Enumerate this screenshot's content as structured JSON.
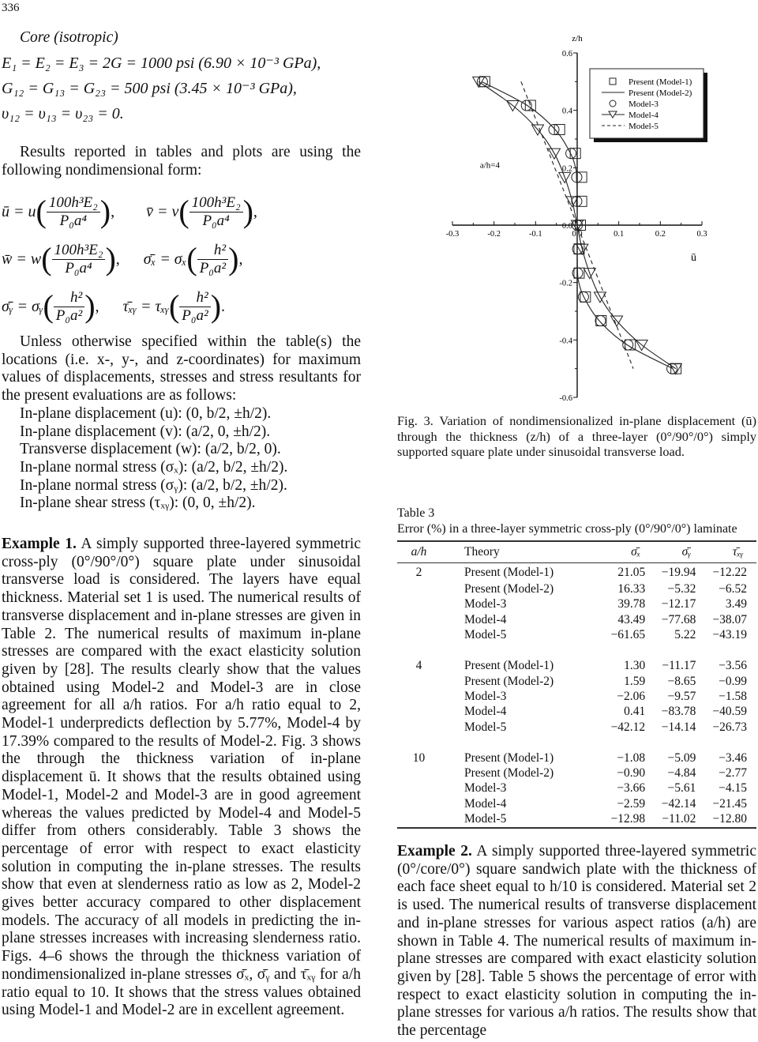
{
  "page": {
    "number": "336"
  },
  "left_column": {
    "core_heading": "Core (isotropic)",
    "material_lines": [
      "E₁ = E₂ = E₃ = 2G = 1000 psi  (6.90 × 10⁻³ GPa),",
      "G₁₂ = G₁₃ = G₂₃ = 500 psi  (3.45 × 10⁻³ GPa),",
      "υ₁₂ = υ₁₃ = υ₂₃ = 0."
    ],
    "intro_paragraph": "Results reported in tables and plots are using the following nondimensional form:",
    "equations": {
      "u_lhs": "ū = u",
      "v_lhs": "v̄ = v",
      "w_lhs": "w̄ = w",
      "sx_lhs": "σ̄ₓ = σₓ",
      "sy_lhs": "σ̄ᵧ = σᵧ",
      "txy_lhs": "τ̄ₓᵧ = τₓᵧ",
      "frac_disp_num": "100h³E₂",
      "frac_disp_den": "P₀a⁴",
      "frac_stress_num": "h²",
      "frac_stress_den": "P₀a²",
      "comma": ",",
      "period": "."
    },
    "locations_paragraph": "Unless otherwise specified within the table(s) the locations (i.e. x-, y-, and z-coordinates) for maximum values of displacements, stresses and stress resultants for the present evaluations are as follows:",
    "locations": [
      "In-plane displacement (u): (0, b/2, ±h/2).",
      "In-plane displacement (v): (a/2, 0, ±h/2).",
      "Transverse displacement (w): (a/2, b/2, 0).",
      "In-plane normal stress (σₓ): (a/2, b/2, ±h/2).",
      "In-plane normal stress (σᵧ): (a/2, b/2, ±h/2).",
      "In-plane shear stress (τₓᵧ): (0, 0, ±h/2)."
    ],
    "example1_label": "Example 1.",
    "example1_text": " A simply supported three-layered symmetric cross-ply (0°/90°/0°) square plate under sinusoidal transverse load is considered. The layers have equal thickness. Material set 1 is used. The numerical results of transverse displacement and in-plane stresses are given in Table 2. The numerical results of maximum in-plane stresses are compared with the exact elasticity solution given by [28]. The results clearly show that the values obtained using Model-2 and Model-3 are in close agreement for all a/h ratios. For a/h ratio equal to 2, Model-1 underpredicts deflection by 5.77%, Model-4 by 17.39% compared to the results of Model-2. Fig. 3 shows the through the thickness variation of in-plane displacement ū. It shows that the results obtained using Model-1, Model-2 and Model-3 are in good agreement whereas the values predicted by Model-4 and Model-5 differ from others considerably. Table 3 shows the percentage of error with respect to exact elasticity solution in computing the in-plane stresses. The results show that even at slenderness ratio as low as 2, Model-2 gives better accuracy compared to other displacement models. The accuracy of all models in predicting the in-plane stresses increases with increasing slenderness ratio. Figs. 4–6 shows the through the thickness variation of nondimensionalized in-plane stresses σ̄ₓ, σ̄ᵧ and τ̄ₓᵧ for a/h ratio equal to 10. It shows that the stress values obtained using Model-1 and Model-2 are in excellent agreement."
  },
  "chart_data": {
    "type": "scatter",
    "title": "",
    "annotation": "a/h=4",
    "xlabel": "ū",
    "ylabel": "z/h",
    "xlim": [
      -0.3,
      0.3
    ],
    "ylim": [
      -0.6,
      0.6
    ],
    "x_ticks": [
      "-0.3",
      "-0.2",
      "-0.1",
      "0.0",
      "0.1",
      "0.2",
      "0.3"
    ],
    "y_ticks": [
      "0.6",
      "0.4",
      "0.2",
      "0.0",
      "-0.2",
      "-0.4",
      "-0.6"
    ],
    "grid": false,
    "legend_position": "top-right",
    "series": [
      {
        "name": "Present (Model-1)",
        "marker": "square",
        "line": "none",
        "z": [
          0.5,
          0.417,
          0.333,
          0.25,
          0.167,
          0.083,
          0.0,
          -0.083,
          -0.167,
          -0.25,
          -0.333,
          -0.417,
          -0.5
        ],
        "u": [
          -0.23,
          -0.12,
          -0.05,
          -0.012,
          0.003,
          0.003,
          0.0,
          -0.003,
          -0.003,
          0.012,
          0.05,
          0.12,
          0.23
        ]
      },
      {
        "name": "Present (Model-2)",
        "marker": "none",
        "line": "solid",
        "z": [
          0.5,
          0.417,
          0.333,
          0.25,
          0.2,
          0.167,
          0.083,
          0.0,
          -0.083,
          -0.167,
          -0.2,
          -0.25,
          -0.333,
          -0.417,
          -0.5
        ],
        "u": [
          -0.23,
          -0.12,
          -0.053,
          -0.016,
          -0.004,
          -0.001,
          0.0,
          0.0,
          0.0,
          0.001,
          0.004,
          0.016,
          0.053,
          0.12,
          0.23
        ]
      },
      {
        "name": "Model-3",
        "marker": "circle",
        "line": "none",
        "z": [
          0.5,
          0.417,
          0.333,
          0.25,
          0.167,
          0.083,
          0.0,
          -0.083,
          -0.167,
          -0.25,
          -0.333,
          -0.417,
          -0.5
        ],
        "u": [
          -0.228,
          -0.122,
          -0.056,
          -0.015,
          -0.001,
          -0.001,
          0.0,
          0.001,
          0.001,
          0.015,
          0.056,
          0.122,
          0.228
        ]
      },
      {
        "name": "Model-4",
        "marker": "triangle-down",
        "line": "solid",
        "z": [
          0.5,
          0.417,
          0.333,
          0.25,
          0.167,
          0.083,
          0.0,
          -0.083,
          -0.167,
          -0.25,
          -0.333,
          -0.417,
          -0.5
        ],
        "u": [
          -0.237,
          -0.155,
          -0.095,
          -0.055,
          -0.03,
          -0.012,
          0.0,
          0.012,
          0.03,
          0.055,
          0.095,
          0.155,
          0.237
        ]
      },
      {
        "name": "Model-5",
        "marker": "none",
        "line": "dashed",
        "z": [
          0.5,
          -0.5
        ],
        "u": [
          -0.135,
          0.135
        ]
      }
    ]
  },
  "figure_caption": "Fig. 3. Variation of nondimensionalized in-plane displacement (ū) through the thickness (z/h) of a three-layer (0°/90°/0°) simply supported square plate under sinusoidal transverse load.",
  "table3": {
    "label": "Table 3",
    "title": "Error (%) in a three-layer symmetric cross-ply (0°/90°/0°) laminate",
    "headers": [
      "a/h",
      "Theory",
      "σ̄ₓ",
      "σ̄ᵧ",
      "τ̄ₓᵧ"
    ],
    "groups": [
      {
        "ah": "2",
        "rows": [
          [
            "Present (Model-1)",
            "21.05",
            "−19.94",
            "−12.22"
          ],
          [
            "Present (Model-2)",
            "16.33",
            "−5.32",
            "−6.52"
          ],
          [
            "Model-3",
            "39.78",
            "−12.17",
            "3.49"
          ],
          [
            "Model-4",
            "43.49",
            "−77.68",
            "−38.07"
          ],
          [
            "Model-5",
            "−61.65",
            "5.22",
            "−43.19"
          ]
        ]
      },
      {
        "ah": "4",
        "rows": [
          [
            "Present (Model-1)",
            "1.30",
            "−11.17",
            "−3.56"
          ],
          [
            "Present (Model-2)",
            "1.59",
            "−8.65",
            "−0.99"
          ],
          [
            "Model-3",
            "−2.06",
            "−9.57",
            "−1.58"
          ],
          [
            "Model-4",
            "0.41",
            "−83.78",
            "−40.59"
          ],
          [
            "Model-5",
            "−42.12",
            "−14.14",
            "−26.73"
          ]
        ]
      },
      {
        "ah": "10",
        "rows": [
          [
            "Present (Model-1)",
            "−1.08",
            "−5.09",
            "−3.46"
          ],
          [
            "Present (Model-2)",
            "−0.90",
            "−4.84",
            "−2.77"
          ],
          [
            "Model-3",
            "−3.66",
            "−5.61",
            "−4.15"
          ],
          [
            "Model-4",
            "−2.59",
            "−42.14",
            "−21.45"
          ],
          [
            "Model-5",
            "−12.98",
            "−11.02",
            "−12.80"
          ]
        ]
      }
    ]
  },
  "right_column": {
    "example2_label": "Example 2.",
    "example2_text": " A simply supported three-layered symmetric (0°/core/0°) square sandwich plate with the thickness of each face sheet equal to h/10 is considered. Material set 2 is used. The numerical results of transverse displacement and in-plane stresses for various aspect ratios (a/h) are shown in Table 4. The numerical results of maximum in-plane stresses are compared with exact elasticity solution given by [28]. Table 5 shows the percentage of error with respect to exact elasticity solution in computing the in-plane stresses for various a/h ratios. The results show that the percentage"
  }
}
